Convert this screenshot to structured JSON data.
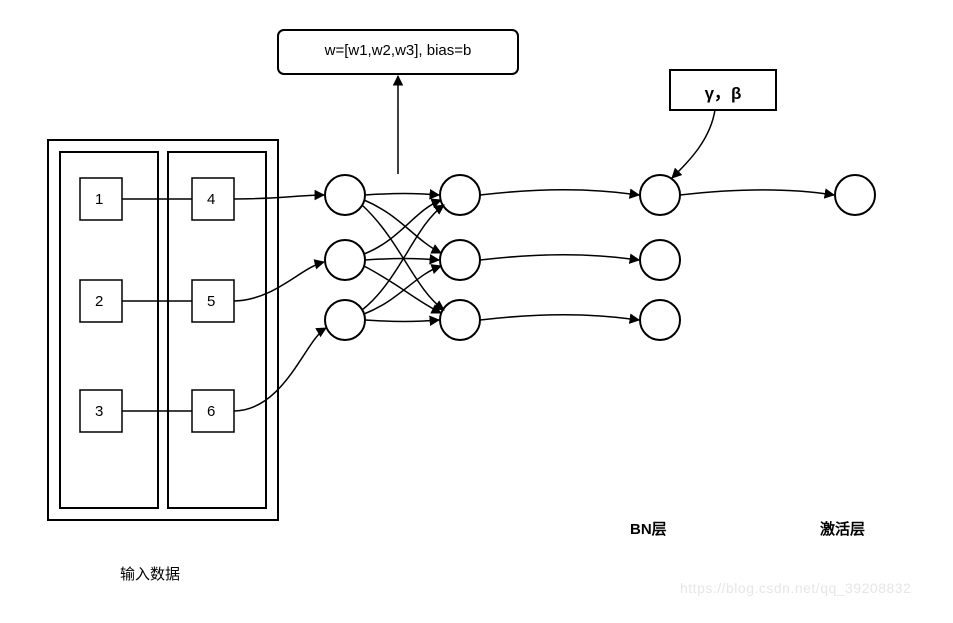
{
  "params_box": {
    "text": "w=[w1,w2,w3], bias=b"
  },
  "gamma_beta_box": {
    "text": "γ，β"
  },
  "input_boxes": {
    "col1": [
      "1",
      "2",
      "3"
    ],
    "col2": [
      "4",
      "5",
      "6"
    ]
  },
  "labels": {
    "input_data": "输入数据",
    "bn_layer": "BN层",
    "activation_layer": "激活层"
  },
  "watermark": "https://blog.csdn.net/qq_39208832"
}
